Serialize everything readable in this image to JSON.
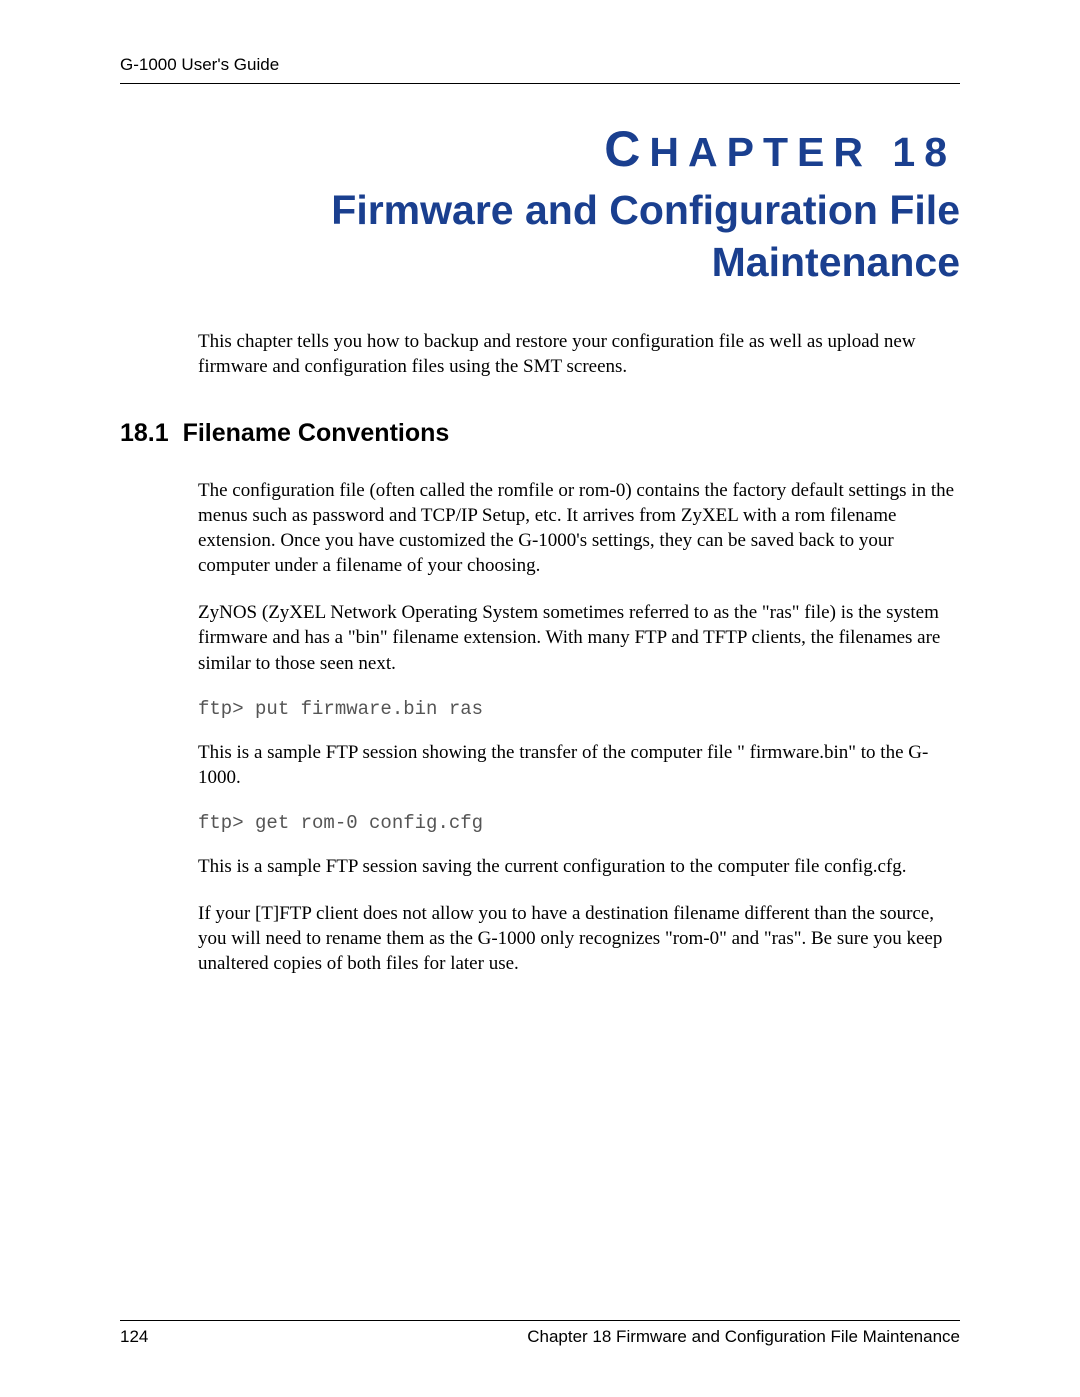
{
  "header": {
    "running_head": "G-1000 User's Guide"
  },
  "chapter": {
    "label_prefix_first": "C",
    "label_prefix_rest": "HAPTER",
    "number": "18",
    "title": "Firmware and Configuration File Maintenance"
  },
  "intro": "This chapter tells you how to backup and restore your configuration file as well as upload new firmware and configuration files using the SMT screens.",
  "section": {
    "number": "18.1",
    "title": "Filename Conventions",
    "p1": "The configuration file (often called the romfile or rom-0) contains the factory default settings in the menus such as password and TCP/IP Setup, etc. It arrives from ZyXEL with a rom filename extension. Once you have customized the G-1000's settings, they can be saved back to your computer under a filename of your choosing.",
    "p2": "ZyNOS (ZyXEL Network Operating System sometimes referred to as the \"ras\" file) is the system firmware and has a \"bin\" filename extension. With many FTP and TFTP clients, the filenames are similar to those seen next.",
    "code1": "ftp> put firmware.bin ras",
    "p3": "This is a sample FTP session showing the transfer of the computer file \" firmware.bin\" to the G-1000.",
    "code2": "ftp> get rom-0 config.cfg",
    "p4": "This is a sample FTP session saving the current configuration to the computer file config.cfg.",
    "p5": "If your [T]FTP client does not allow you to have a destination filename different than the source, you will need to rename them as the G-1000 only recognizes \"rom-0\" and \"ras\". Be sure you keep unaltered copies of both files for later use."
  },
  "footer": {
    "page_number": "124",
    "running_foot": "Chapter 18 Firmware and Configuration File Maintenance"
  }
}
